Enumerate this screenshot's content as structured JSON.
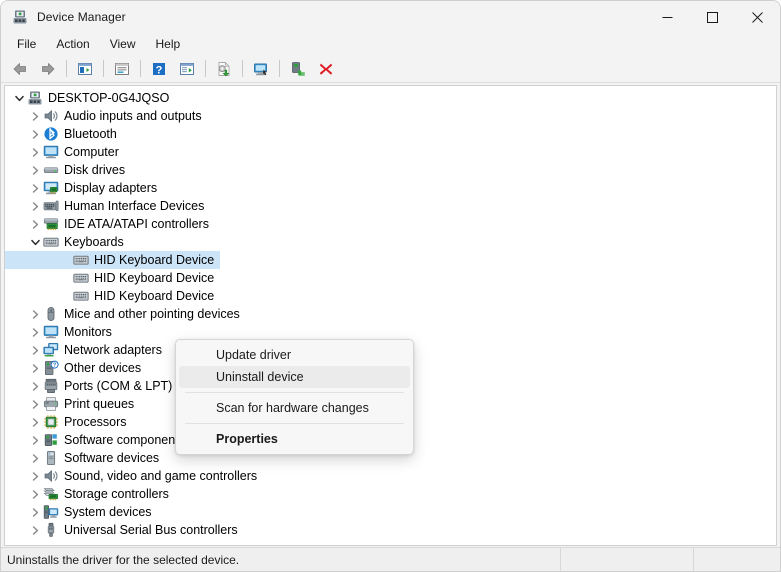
{
  "window": {
    "title": "Device Manager",
    "title_icon": "device-manager-icon",
    "controls": {
      "minimize": "minimize-icon",
      "maximize": "maximize-icon",
      "close": "close-icon"
    }
  },
  "menubar": {
    "items": [
      {
        "label": "File"
      },
      {
        "label": "Action"
      },
      {
        "label": "View"
      },
      {
        "label": "Help"
      }
    ]
  },
  "toolbar": {
    "buttons": [
      {
        "name": "back-button",
        "icon": "back-arrow-icon"
      },
      {
        "name": "forward-button",
        "icon": "forward-arrow-icon"
      },
      {
        "name": "separator-1",
        "icon": "separator"
      },
      {
        "name": "show-hide-console-tree-button",
        "icon": "console-tree-icon"
      },
      {
        "name": "separator-2",
        "icon": "separator"
      },
      {
        "name": "properties-button",
        "icon": "properties-window-icon"
      },
      {
        "name": "separator-3",
        "icon": "separator"
      },
      {
        "name": "help-button",
        "icon": "help-question-icon"
      },
      {
        "name": "show-hide-action-pane-button",
        "icon": "action-pane-icon"
      },
      {
        "name": "separator-4",
        "icon": "separator"
      },
      {
        "name": "update-driver-button",
        "icon": "update-driver-icon"
      },
      {
        "name": "separator-5",
        "icon": "separator"
      },
      {
        "name": "scan-for-hardware-changes-button",
        "icon": "scan-hardware-icon"
      },
      {
        "name": "separator-6",
        "icon": "separator"
      },
      {
        "name": "enable-device-button",
        "icon": "enable-device-icon"
      },
      {
        "name": "uninstall-device-button",
        "icon": "red-x-icon"
      }
    ]
  },
  "tree": {
    "nodes": [
      {
        "label": "DESKTOP-0G4JQSO",
        "depth": 0,
        "state": "expanded",
        "icon": "computer-root-icon",
        "selected": false
      },
      {
        "label": "Audio inputs and outputs",
        "depth": 1,
        "state": "collapsed",
        "icon": "speaker-icon",
        "selected": false
      },
      {
        "label": "Bluetooth",
        "depth": 1,
        "state": "collapsed",
        "icon": "bluetooth-icon",
        "selected": false
      },
      {
        "label": "Computer",
        "depth": 1,
        "state": "collapsed",
        "icon": "monitor-icon",
        "selected": false
      },
      {
        "label": "Disk drives",
        "depth": 1,
        "state": "collapsed",
        "icon": "disk-drive-icon",
        "selected": false
      },
      {
        "label": "Display adapters",
        "depth": 1,
        "state": "collapsed",
        "icon": "display-adapter-icon",
        "selected": false
      },
      {
        "label": "Human Interface Devices",
        "depth": 1,
        "state": "collapsed",
        "icon": "hid-icon",
        "selected": false
      },
      {
        "label": "IDE ATA/ATAPI controllers",
        "depth": 1,
        "state": "collapsed",
        "icon": "ide-controller-icon",
        "selected": false
      },
      {
        "label": "Keyboards",
        "depth": 1,
        "state": "expanded",
        "icon": "keyboard-icon",
        "selected": false
      },
      {
        "label": "HID Keyboard Device",
        "depth": 2,
        "state": "leaf",
        "icon": "keyboard-icon",
        "selected": true
      },
      {
        "label": "HID Keyboard Device",
        "depth": 2,
        "state": "leaf",
        "icon": "keyboard-icon",
        "selected": false
      },
      {
        "label": "HID Keyboard Device",
        "depth": 2,
        "state": "leaf",
        "icon": "keyboard-icon",
        "selected": false
      },
      {
        "label": "Mice and other pointing devices",
        "depth": 1,
        "state": "collapsed",
        "icon": "mouse-icon",
        "selected": false
      },
      {
        "label": "Monitors",
        "depth": 1,
        "state": "collapsed",
        "icon": "monitor-icon",
        "selected": false
      },
      {
        "label": "Network adapters",
        "depth": 1,
        "state": "collapsed",
        "icon": "network-adapter-icon",
        "selected": false
      },
      {
        "label": "Other devices",
        "depth": 1,
        "state": "collapsed",
        "icon": "other-device-icon",
        "selected": false
      },
      {
        "label": "Ports (COM & LPT)",
        "depth": 1,
        "state": "collapsed",
        "icon": "port-icon",
        "selected": false
      },
      {
        "label": "Print queues",
        "depth": 1,
        "state": "collapsed",
        "icon": "printer-icon",
        "selected": false
      },
      {
        "label": "Processors",
        "depth": 1,
        "state": "collapsed",
        "icon": "processor-icon",
        "selected": false
      },
      {
        "label": "Software components",
        "depth": 1,
        "state": "collapsed",
        "icon": "software-component-icon",
        "selected": false
      },
      {
        "label": "Software devices",
        "depth": 1,
        "state": "collapsed",
        "icon": "software-device-icon",
        "selected": false
      },
      {
        "label": "Sound, video and game controllers",
        "depth": 1,
        "state": "collapsed",
        "icon": "speaker-icon",
        "selected": false
      },
      {
        "label": "Storage controllers",
        "depth": 1,
        "state": "collapsed",
        "icon": "storage-controller-icon",
        "selected": false
      },
      {
        "label": "System devices",
        "depth": 1,
        "state": "collapsed",
        "icon": "system-device-icon",
        "selected": false
      },
      {
        "label": "Universal Serial Bus controllers",
        "depth": 1,
        "state": "collapsed",
        "icon": "usb-icon",
        "selected": false
      }
    ]
  },
  "context_menu": {
    "items": [
      {
        "label": "Update driver",
        "kind": "item",
        "hover": false,
        "bold": false
      },
      {
        "label": "Uninstall device",
        "kind": "item",
        "hover": true,
        "bold": false
      },
      {
        "kind": "separator"
      },
      {
        "label": "Scan for hardware changes",
        "kind": "item",
        "hover": false,
        "bold": false
      },
      {
        "kind": "separator"
      },
      {
        "label": "Properties",
        "kind": "item",
        "hover": false,
        "bold": true
      }
    ]
  },
  "statusbar": {
    "message": "Uninstalls the driver for the selected device.",
    "pane2": "",
    "pane3": ""
  },
  "colors": {
    "selection": "#cce4f7",
    "menu_hover": "#ebebeb",
    "window_bg": "#f3f3f3",
    "content_bg": "#ffffff",
    "status_bg": "#efefef",
    "red_x": "#e01b24",
    "bluetooth_blue": "#1c7fd4"
  }
}
